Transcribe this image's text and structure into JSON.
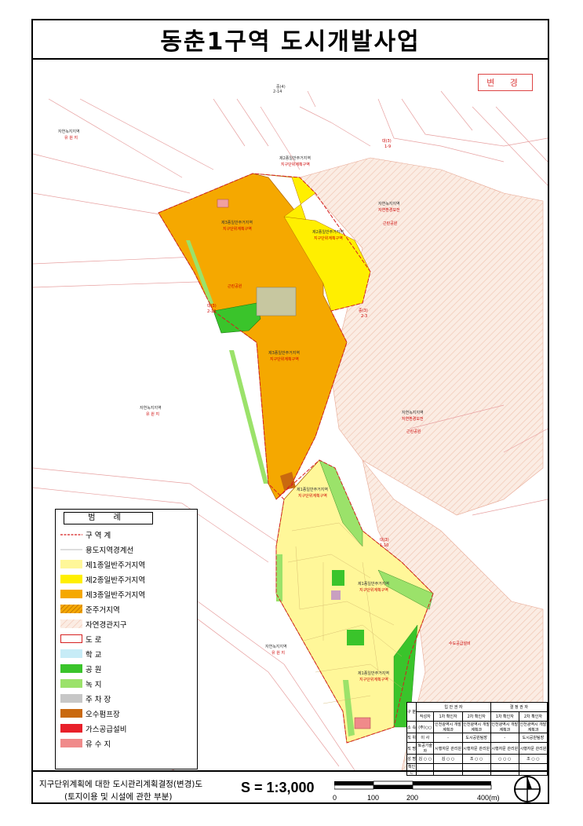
{
  "title": "동춘1구역 도시개발사업",
  "stamp": "변 경",
  "footer": {
    "line1": "지구단위계획에 대한 도시관리계획결정(변경)도",
    "line2": "(토지이용 및 시설에 관한 부분)",
    "scale": "S = 1:3,000",
    "bar_labels": [
      "0",
      "100",
      "200",
      "400(m)"
    ]
  },
  "legend": {
    "title": "범 례",
    "items": [
      {
        "label": "구 역 계",
        "color": "#d62020",
        "kind": "boundary"
      },
      {
        "label": "용도지역경계선",
        "color": "#bbbbbb",
        "kind": "line"
      },
      {
        "label": "제1종일반주거지역",
        "color": "#fff799",
        "kind": "fill"
      },
      {
        "label": "제2종일반주거지역",
        "color": "#ffef00",
        "kind": "fill"
      },
      {
        "label": "제3종일반주거지역",
        "color": "#f5a800",
        "kind": "fill"
      },
      {
        "label": "준주거지역",
        "color": "#e38b00",
        "kind": "hatch"
      },
      {
        "label": "자연경관지구",
        "color": "#f5d9c9",
        "kind": "hatch-light"
      },
      {
        "label": "도 로",
        "color": "#ffffff",
        "kind": "road"
      },
      {
        "label": "학 교",
        "color": "#c7ecf7",
        "kind": "fill"
      },
      {
        "label": "공 원",
        "color": "#3ac42b",
        "kind": "fill"
      },
      {
        "label": "녹 지",
        "color": "#9be26a",
        "kind": "fill"
      },
      {
        "label": "주 차 장",
        "color": "#c7c7c7",
        "kind": "fill"
      },
      {
        "label": "오수펌프장",
        "color": "#c9690f",
        "kind": "fill"
      },
      {
        "label": "가스공급설비",
        "color": "#e8202a",
        "kind": "fill"
      },
      {
        "label": "유 수 지",
        "color": "#f08a8a",
        "kind": "fill"
      }
    ]
  },
  "map_labels": [
    {
      "text": "자연녹지지역",
      "cls": ""
    },
    {
      "text": "유 원 지",
      "cls": "red"
    },
    {
      "text": "대(3)",
      "cls": "red"
    },
    {
      "text": "1-9",
      "cls": "red"
    },
    {
      "text": "자연녹지지역",
      "cls": ""
    },
    {
      "text": "자연환경보전",
      "cls": "red"
    },
    {
      "text": "근린공원",
      "cls": "red"
    },
    {
      "text": "제2종일반주거지역",
      "cls": ""
    },
    {
      "text": "지구단위계획구역",
      "cls": "red"
    },
    {
      "text": "제3종일반주거지역",
      "cls": ""
    },
    {
      "text": "지구단위계획구역",
      "cls": "red"
    },
    {
      "text": "제2종일반주거지역",
      "cls": ""
    },
    {
      "text": "지구단위계획구역",
      "cls": "red"
    },
    {
      "text": "근린공원",
      "cls": "red"
    },
    {
      "text": "중(4)",
      "cls": ""
    },
    {
      "text": "2-14",
      "cls": ""
    },
    {
      "text": "대(3)",
      "cls": "red"
    },
    {
      "text": "2-10",
      "cls": "red"
    },
    {
      "text": "중(3)",
      "cls": "red"
    },
    {
      "text": "2-3",
      "cls": "red"
    },
    {
      "text": "제3종일반주거지역",
      "cls": ""
    },
    {
      "text": "지구단위계획구역",
      "cls": "red"
    },
    {
      "text": "자연녹지지역",
      "cls": ""
    },
    {
      "text": "유 원 지",
      "cls": "red"
    },
    {
      "text": "자연녹지지역",
      "cls": ""
    },
    {
      "text": "자연환경보전",
      "cls": "red"
    },
    {
      "text": "근린공원",
      "cls": "red"
    },
    {
      "text": "제1종일반주거지역",
      "cls": ""
    },
    {
      "text": "지구단위계획구역",
      "cls": "red"
    },
    {
      "text": "대(3)",
      "cls": "red"
    },
    {
      "text": "1-10",
      "cls": "red"
    },
    {
      "text": "제1종일반주거지역",
      "cls": ""
    },
    {
      "text": "지구단위계획구역",
      "cls": "red"
    },
    {
      "text": "제1종일반주거지역",
      "cls": ""
    },
    {
      "text": "지구단위계획구역",
      "cls": "red"
    },
    {
      "text": "자연녹지지역",
      "cls": ""
    },
    {
      "text": "유 원 지",
      "cls": "red"
    },
    {
      "text": "수도공급설비",
      "cls": "red"
    }
  ],
  "info_table": {
    "header": [
      "구 분",
      "입 안 권 자",
      "결 정 권 자"
    ],
    "sub": [
      "",
      "작성자",
      "1차 확인자",
      "2차 확인자",
      "1차 확인자",
      "2차 확인자"
    ],
    "rows": [
      [
        "소 속",
        "(주)○○",
        "인천광역시 개발계획과",
        "인천광역시 개발계획과",
        "인천광역시 개발계획과",
        "인천광역시 개발계획과"
      ],
      [
        "직 위",
        "이 사",
        "-",
        "도시공원팀장",
        "-",
        "도시공원팀장"
      ],
      [
        "직 명",
        "토공기술자",
        "시행자문 관리원",
        "시행자문 관리원",
        "시행자문 관리원",
        "시행자문 관리원"
      ],
      [
        "성 명",
        "김 ○ ○",
        "김 ○ ○",
        "조 ○ ○",
        "○ ○ ○",
        "조 ○ ○"
      ],
      [
        "확인인",
        "",
        "",
        "",
        "",
        ""
      ]
    ]
  }
}
